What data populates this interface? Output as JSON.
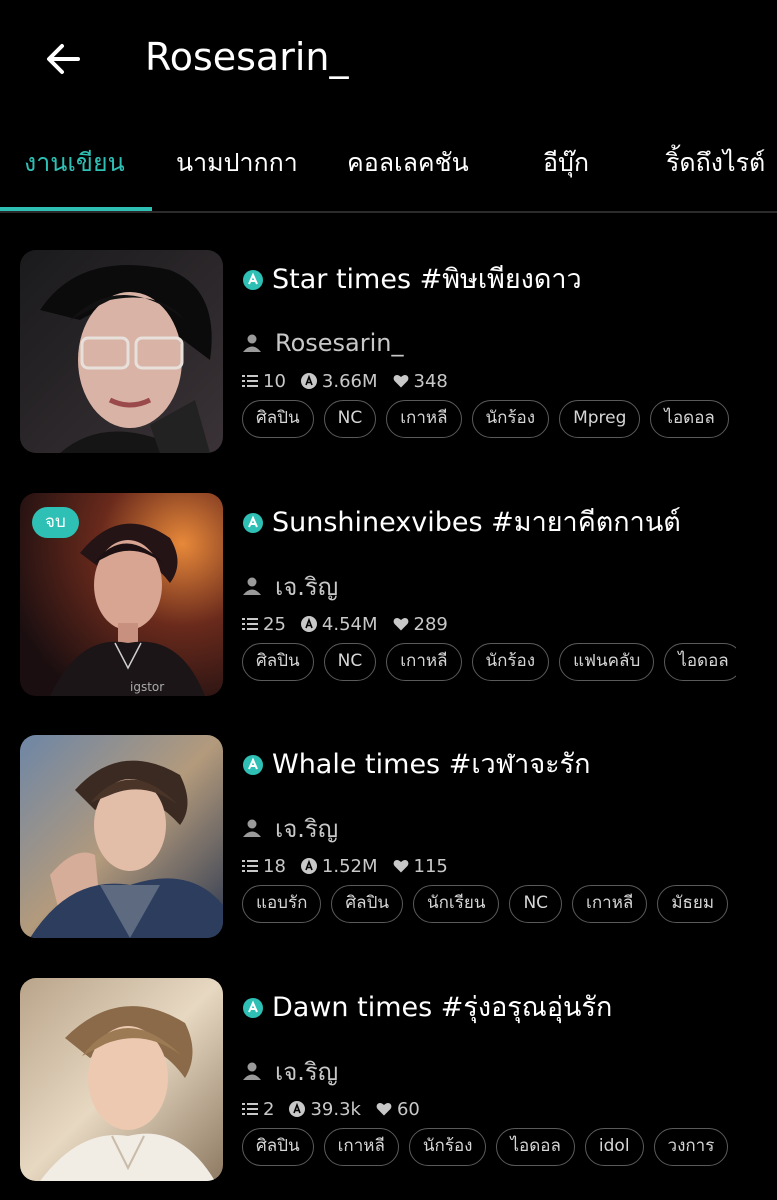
{
  "header": {
    "title": "Rosesarin_",
    "back_icon": "arrow-left-icon"
  },
  "tabs": [
    {
      "label": "งานเขียน",
      "active": true
    },
    {
      "label": "นามปากกา",
      "active": false
    },
    {
      "label": "คอลเลคชัน",
      "active": false
    },
    {
      "label": "อีบุ๊ก",
      "active": false
    },
    {
      "label": "ริ้ดถึงไรต์",
      "active": false
    }
  ],
  "colors": {
    "accent": "#2fc0b5",
    "background": "#000000",
    "muted_text": "#c8c8c8"
  },
  "stories": [
    {
      "title": "Star times #พิษเพียงดาว",
      "author": "Rosesarin_",
      "chapters": "10",
      "views": "3.66M",
      "likes": "348",
      "badge": "",
      "tags": [
        "ศิลปิน",
        "NC",
        "เกาหลี",
        "นักร้อง",
        "Mpreg",
        "ไอดอล"
      ]
    },
    {
      "title": "Sunshinexvibes #มายาคีตกานต์",
      "author": "เจ.ริญ",
      "chapters": "25",
      "views": "4.54M",
      "likes": "289",
      "badge": "จบ",
      "tags": [
        "ศิลปิน",
        "NC",
        "เกาหลี",
        "นักร้อง",
        "แฟนคลับ",
        "ไอดอล"
      ]
    },
    {
      "title": "Whale times #เวฬาจะรัก",
      "author": "เจ.ริญ",
      "chapters": "18",
      "views": "1.52M",
      "likes": "115",
      "badge": "",
      "tags": [
        "แอบรัก",
        "ศิลปิน",
        "นักเรียน",
        "NC",
        "เกาหลี",
        "มัธยม"
      ]
    },
    {
      "title": "Dawn times #รุ่งอรุณอุ่นรัก",
      "author": "เจ.ริญ",
      "chapters": "2",
      "views": "39.3k",
      "likes": "60",
      "badge": "",
      "tags": [
        "ศิลปิน",
        "เกาหลี",
        "นักร้อง",
        "ไอดอล",
        "idol",
        "วงการ"
      ]
    }
  ]
}
